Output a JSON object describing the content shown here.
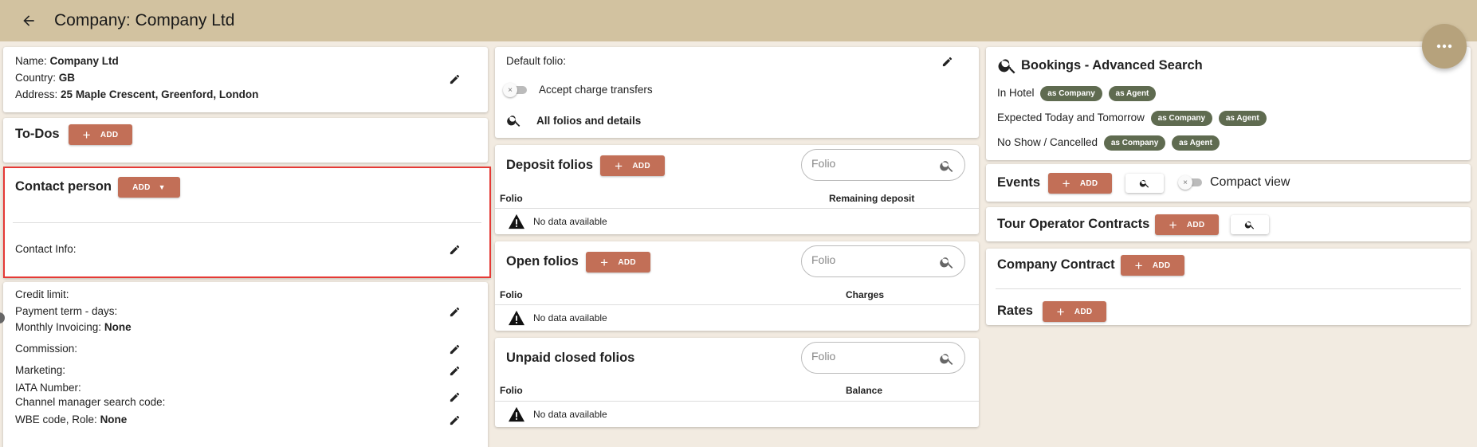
{
  "header": {
    "title": "Company: Company Ltd"
  },
  "company_info": {
    "name_label": "Name:",
    "name_value": "Company Ltd",
    "country_label": "Country:",
    "country_value": "GB",
    "address_label": "Address:",
    "address_value": "25 Maple Crescent, Greenford, London"
  },
  "todos": {
    "title": "To-Dos",
    "add_label": "ADD"
  },
  "contact_person": {
    "title": "Contact person",
    "add_label": "ADD",
    "contact_info_label": "Contact Info:"
  },
  "financial": {
    "credit_limit_label": "Credit limit:",
    "payment_term_label": "Payment term - days:",
    "monthly_invoicing_label": "Monthly Invoicing:",
    "monthly_invoicing_value": "None",
    "commission_label": "Commission:",
    "marketing_label": "Marketing:",
    "iata_label": "IATA Number:",
    "channel_manager_label": "Channel manager search code:",
    "wbe_label": "WBE code, Role:",
    "wbe_value": "None"
  },
  "folio_settings": {
    "default_folio_label": "Default folio:",
    "accept_charge_transfers_label": "Accept charge transfers",
    "all_folios_label": "All folios and details"
  },
  "deposit_folios": {
    "title": "Deposit folios",
    "add_label": "ADD",
    "search_placeholder": "Folio",
    "columns": [
      "Folio",
      "Remaining deposit"
    ],
    "empty_text": "No data available"
  },
  "open_folios": {
    "title": "Open folios",
    "add_label": "ADD",
    "search_placeholder": "Folio",
    "columns": [
      "Folio",
      "Charges"
    ],
    "empty_text": "No data available"
  },
  "unpaid_closed_folios": {
    "title": "Unpaid closed folios",
    "search_placeholder": "Folio",
    "columns": [
      "Folio",
      "Balance"
    ],
    "empty_text": "No data available"
  },
  "bookings_search": {
    "title": "Bookings - Advanced Search",
    "rows": [
      {
        "label": "In Hotel",
        "chips": [
          "as Company",
          "as Agent"
        ]
      },
      {
        "label": "Expected Today and Tomorrow",
        "chips": [
          "as Company",
          "as Agent"
        ]
      },
      {
        "label": "No Show / Cancelled",
        "chips": [
          "as Company",
          "as Agent"
        ]
      }
    ]
  },
  "events": {
    "title": "Events",
    "add_label": "ADD",
    "compact_view_label": "Compact view"
  },
  "tour_operator_contracts": {
    "title": "Tour Operator Contracts",
    "add_label": "ADD"
  },
  "company_contract": {
    "title": "Company Contract",
    "add_label": "ADD"
  },
  "rates": {
    "title": "Rates",
    "add_label": "ADD"
  },
  "icons": {
    "back": "arrow-left-icon",
    "more": "more-horizontal-icon",
    "edit": "pencil-icon",
    "search": "search-icon",
    "warning": "warning-triangle-icon"
  },
  "colors": {
    "header_bg": "#d2c2a0",
    "accent_button": "#c26f57",
    "chip_bg": "#5f6b50",
    "page_bg": "#f2ebe1",
    "highlight": "#e53935"
  }
}
